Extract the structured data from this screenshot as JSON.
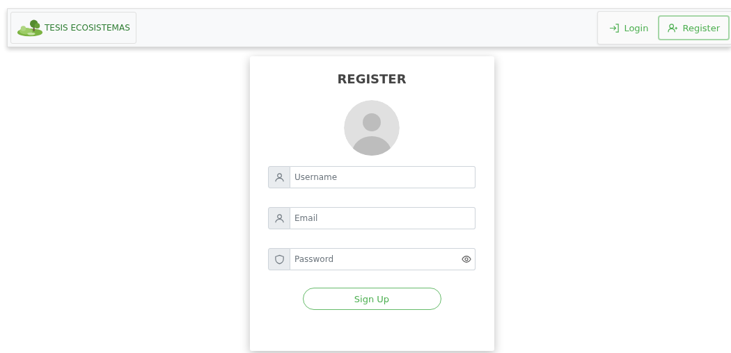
{
  "brand": {
    "name": "TESIS ECOSISTEMAS"
  },
  "nav": [
    {
      "label": "Login",
      "selected": false
    },
    {
      "label": "Register",
      "selected": true
    }
  ],
  "form": {
    "title": "REGISTER",
    "fields": [
      {
        "placeholder": "Username",
        "kind": "text",
        "toggle": false
      },
      {
        "placeholder": "Email",
        "kind": "text",
        "toggle": false
      },
      {
        "placeholder": "Password",
        "kind": "password",
        "toggle": true
      }
    ],
    "submit": "Sign Up"
  }
}
